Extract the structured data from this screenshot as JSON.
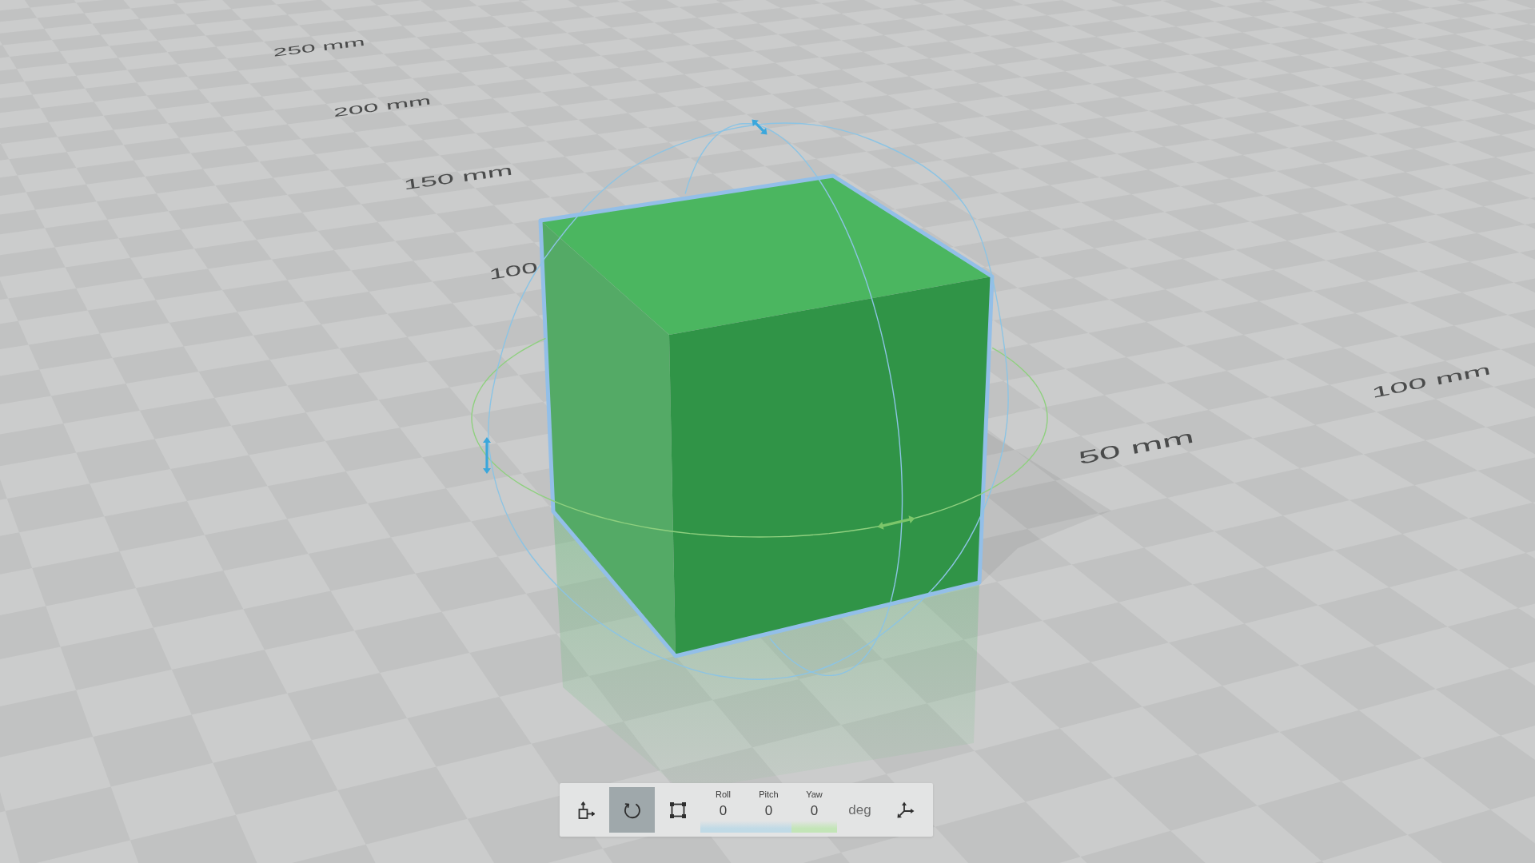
{
  "viewport": {
    "ruler_labels": [
      "250 mm",
      "200 mm",
      "150 mm",
      "100",
      "50 mm",
      "100 mm"
    ]
  },
  "model": {
    "selected": true
  },
  "toolbar": {
    "tools": [
      {
        "kind": "move",
        "selected": false
      },
      {
        "kind": "rotate",
        "selected": true
      },
      {
        "kind": "scale",
        "selected": false
      }
    ],
    "rotation_fields": [
      {
        "label": "Roll",
        "value": "0",
        "color": "#c0dae6"
      },
      {
        "label": "Pitch",
        "value": "0",
        "color": "#c0dae6"
      },
      {
        "label": "Yaw",
        "value": "0",
        "color": "#c3e5b7"
      }
    ],
    "unit": "deg"
  }
}
